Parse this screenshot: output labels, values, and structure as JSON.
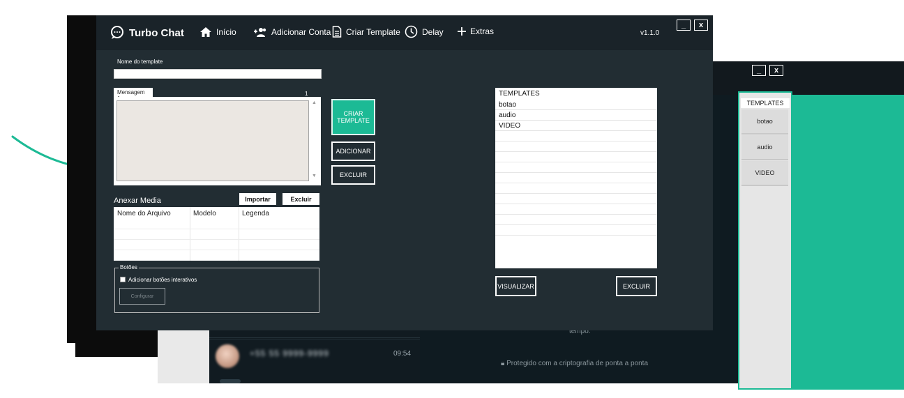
{
  "colors": {
    "accent": "#1cba95",
    "window_bg": "#222d33",
    "titlebar_bg": "#1a2329"
  },
  "app": {
    "brand": "Turbo Chat",
    "version": "v1.1.0",
    "nav": [
      {
        "label": "Início",
        "icon": "home-icon"
      },
      {
        "label": "Adicionar Conta",
        "icon": "add-users-icon"
      },
      {
        "label": "Criar Template",
        "icon": "document-icon"
      },
      {
        "label": "Delay",
        "icon": "clock-icon"
      },
      {
        "label": "Extras",
        "icon": "plus-icon"
      }
    ],
    "window_buttons": {
      "minimize": "_",
      "close": "x"
    }
  },
  "form": {
    "template_name_label": "Nome do template",
    "template_name_value": "",
    "message_tab": "Mensagem 1",
    "message_tab_badge": "1",
    "message_value": "",
    "attach_label": "Anexar Media",
    "import_button": "Importar",
    "delete_media_button": "Excluir",
    "media_columns": [
      "Nome do Arquivo",
      "Modelo",
      "Legenda"
    ],
    "buttons_group_title": "Botões",
    "interactive_checkbox_label": "Adicionar botões interativos",
    "configure_button": "Configurar"
  },
  "actions": {
    "create_template": "CRIAR TEMPLATE",
    "add": "ADICIONAR",
    "delete": "EXCLUIR"
  },
  "templates": {
    "header": "TEMPLATES",
    "items": [
      "botao",
      "audio",
      "VIDEO"
    ],
    "view_button": "VISUALIZAR",
    "delete_button": "EXCLUIR"
  },
  "side_panel": {
    "header": "TEMPLATES",
    "items": [
      "botao",
      "audio",
      "VIDEO"
    ],
    "window_buttons": {
      "minimize": "_",
      "close": "x"
    }
  },
  "background_chat": {
    "contact_time": "09:54",
    "contact_name_blurred": "+55 55 9999-9999",
    "muted_text": "tempo.",
    "encryption_note": "Protegido com a criptografia de ponta a ponta"
  }
}
